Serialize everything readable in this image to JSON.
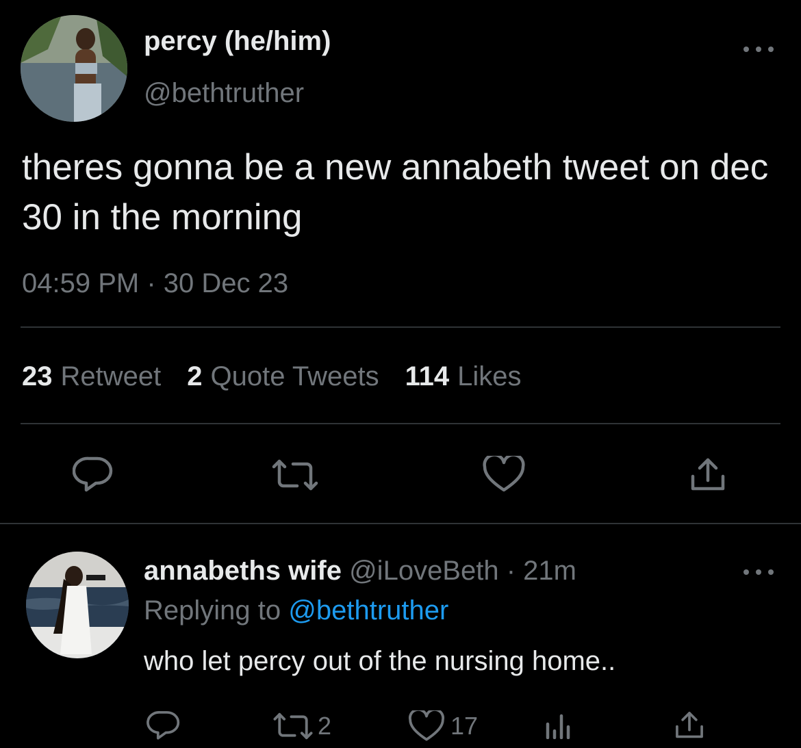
{
  "main_tweet": {
    "author_name": "percy (he/him)",
    "author_handle": "@bethtruther",
    "text": "theres gonna be a new annabeth tweet on dec 30 in the morning",
    "timestamp": "04:59 PM · 30 Dec 23",
    "stats": {
      "retweets_count": "23",
      "retweets_label": "Retweet",
      "quotes_count": "2",
      "quotes_label": "Quote Tweets",
      "likes_count": "114",
      "likes_label": "Likes"
    },
    "actions": [
      "reply-icon",
      "retweet-icon",
      "like-icon",
      "share-icon"
    ]
  },
  "reply_tweet": {
    "author_name": "annabeths wife",
    "author_handle": "@iLoveBeth",
    "time_ago": "21m",
    "separator": " · ",
    "replying_label": "Replying to",
    "replying_handle": "@bethtruther",
    "text": "who let percy out of the nursing home..",
    "retweet_count": "2",
    "like_count": "17",
    "actions": [
      "reply-icon",
      "retweet-icon",
      "like-icon",
      "analytics-icon",
      "share-icon"
    ]
  },
  "colors": {
    "background": "#000000",
    "primary_text": "#e7e9ea",
    "secondary_text": "#71767b",
    "link": "#1d9bf0",
    "divider": "#2f3336"
  }
}
